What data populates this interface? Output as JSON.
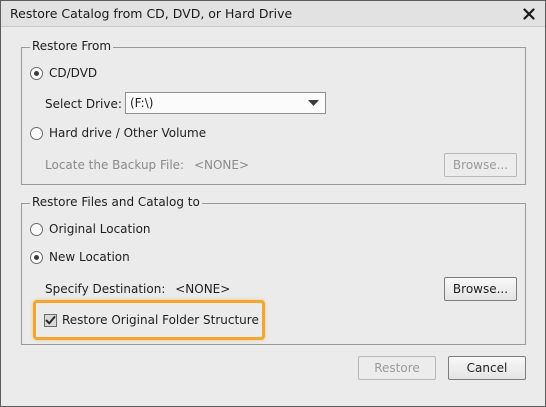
{
  "window": {
    "title": "Restore Catalog from CD, DVD, or Hard Drive",
    "close_icon": "close-icon"
  },
  "restore_from": {
    "legend": "Restore From",
    "cd_dvd_label": "CD/DVD",
    "cd_dvd_selected": true,
    "select_drive_label": "Select Drive:",
    "drive_value": "(F:\\)",
    "hard_drive_label": "Hard drive / Other Volume",
    "hard_drive_selected": false,
    "locate_label": "Locate the Backup File:",
    "locate_value": "<NONE>",
    "browse_label": "Browse...",
    "browse_enabled": false
  },
  "restore_to": {
    "legend": "Restore Files and Catalog to",
    "original_label": "Original Location",
    "original_selected": false,
    "new_label": "New Location",
    "new_selected": true,
    "destination_label": "Specify Destination:",
    "destination_value": "<NONE>",
    "browse_label": "Browse...",
    "browse_enabled": true,
    "folder_structure_label": "Restore Original Folder Structure",
    "folder_structure_checked": true
  },
  "footer": {
    "restore_label": "Restore",
    "restore_enabled": false,
    "cancel_label": "Cancel"
  },
  "colors": {
    "highlight": "#f0a830",
    "dialog_bg": "#ebebeb"
  }
}
